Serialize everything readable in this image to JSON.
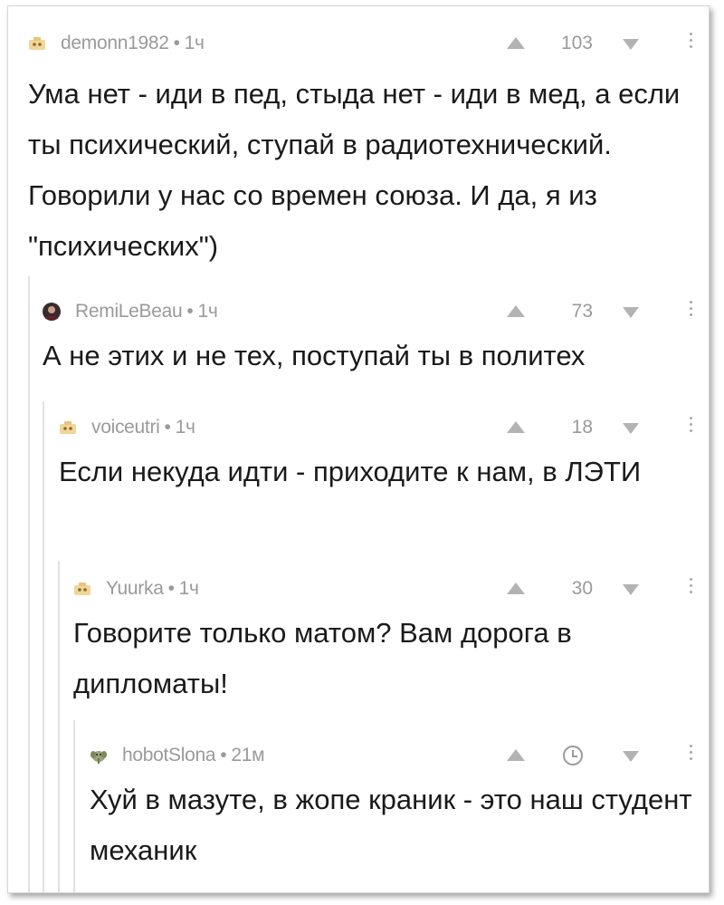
{
  "comments": [
    {
      "author": "demonn1982",
      "time": "1ч",
      "rating": "103",
      "text": "Ума нет - иди в пед, стыда нет - иди в мед, а если ты психический, ступай в радиотехнический. Говорили у нас со времен союза. И да, я из \"психических\")",
      "avatar": "default-avatar-icon"
    },
    {
      "author": "RemiLeBeau",
      "time": "1ч",
      "rating": "73",
      "text": "А не этих и не тех, поступай ты в политех",
      "avatar": "user-avatar-photo"
    },
    {
      "author": "voiceutri",
      "time": "1ч",
      "rating": "18",
      "text": "Если некуда идти - приходите к нам, в ЛЭТИ",
      "avatar": "default-avatar-icon"
    },
    {
      "author": "Yuurka",
      "time": "1ч",
      "rating": "30",
      "text": "Говорите только матом? Вам дорога в дипломаты!",
      "avatar": "default-avatar-icon"
    },
    {
      "author": "hobotSlona",
      "time": "21м",
      "rating": "",
      "text": "Хуй в мазуте, в жопе краник - это наш студент механик",
      "avatar": "elephant-avatar-icon"
    }
  ],
  "separator": "•"
}
